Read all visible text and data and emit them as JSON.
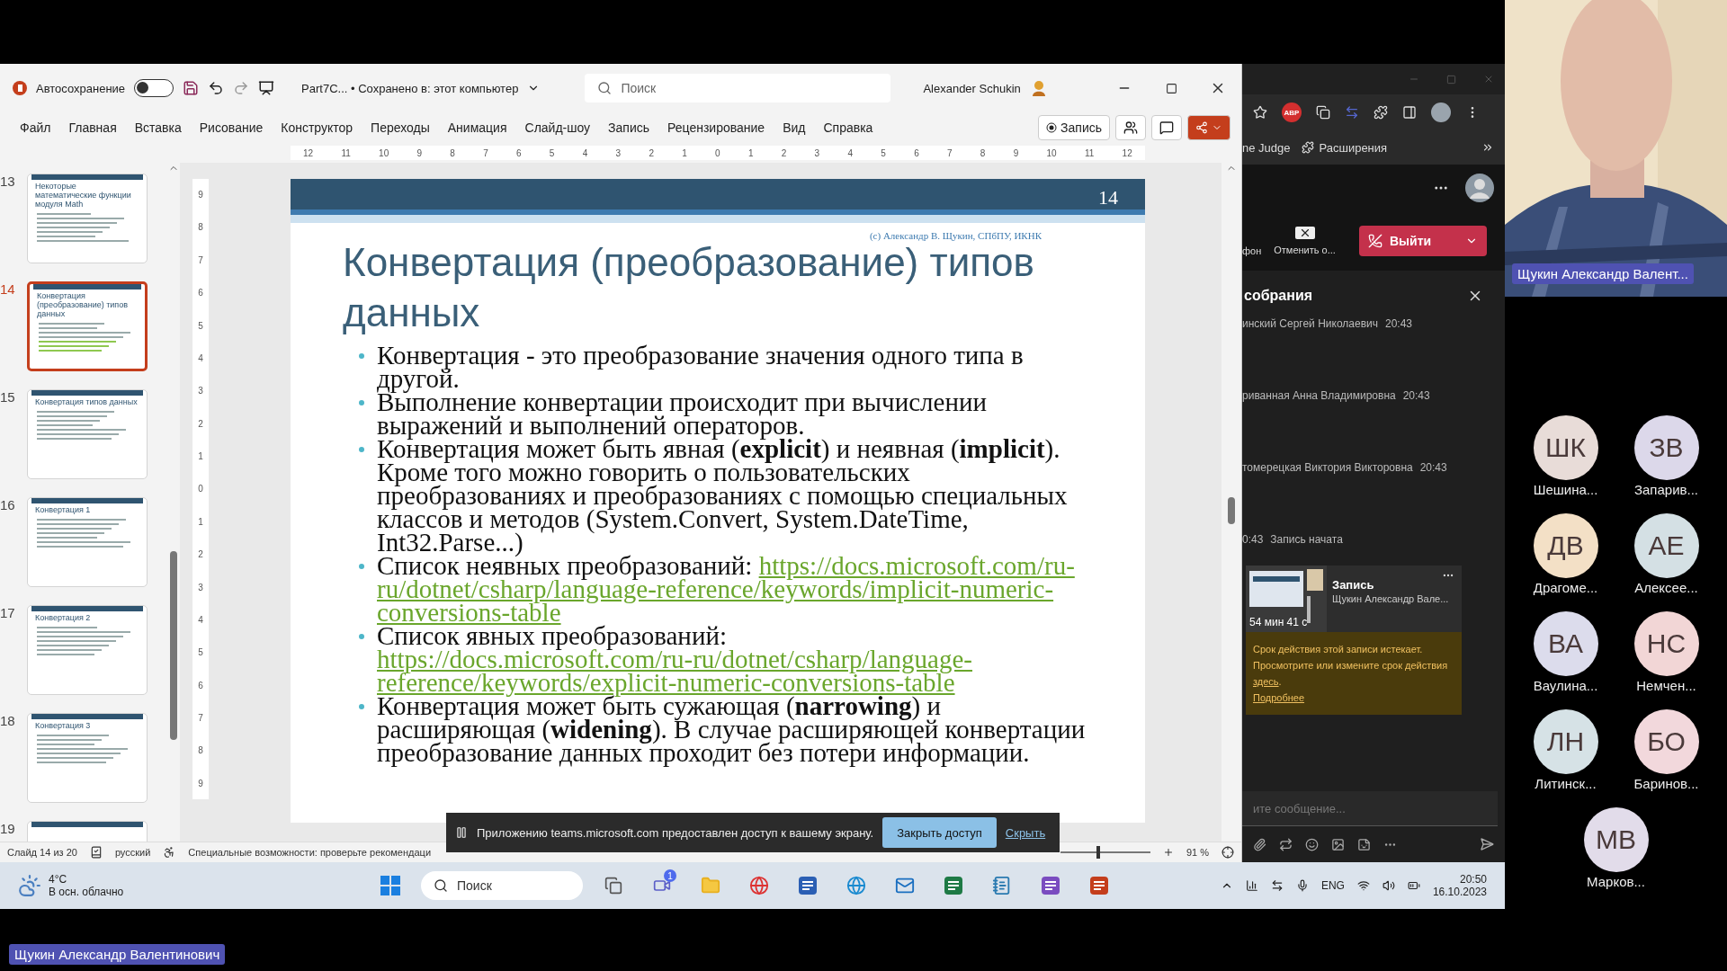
{
  "ppt": {
    "autosave": {
      "label": "Автосохранение",
      "on": false
    },
    "file_title": "Part7C... • Сохранено в: этот компьютер",
    "search": {
      "placeholder": "Поиск"
    },
    "user": "Alexander Schukin",
    "tabs": [
      "Файл",
      "Главная",
      "Вставка",
      "Рисование",
      "Конструктор",
      "Переходы",
      "Анимация",
      "Слайд-шоу",
      "Запись",
      "Рецензирование",
      "Вид",
      "Справка"
    ],
    "record_button": "Запись",
    "ruler_h": [
      "12",
      "11",
      "10",
      "9",
      "8",
      "7",
      "6",
      "5",
      "4",
      "3",
      "2",
      "1",
      "0",
      "1",
      "2",
      "3",
      "4",
      "5",
      "6",
      "7",
      "8",
      "9",
      "10",
      "11",
      "12"
    ],
    "ruler_v": [
      "9",
      "8",
      "7",
      "6",
      "5",
      "4",
      "3",
      "2",
      "1",
      "0",
      "1",
      "2",
      "3",
      "4",
      "5",
      "6",
      "7",
      "8",
      "9"
    ],
    "thumbnails": [
      {
        "number": "13",
        "title": "Некоторые математические функции модуля Math",
        "selected": false
      },
      {
        "number": "14",
        "title": "Конвертация (преобразование) типов данных",
        "selected": true
      },
      {
        "number": "15",
        "title": "Конвертация типов данных",
        "selected": false
      },
      {
        "number": "16",
        "title": "Конвертация 1",
        "selected": false
      },
      {
        "number": "17",
        "title": "Конвертация 2",
        "selected": false
      },
      {
        "number": "18",
        "title": "Конвертация 3",
        "selected": false
      },
      {
        "number": "19",
        "selected": false
      }
    ],
    "slide": {
      "number": "14",
      "copyright": "(c) Александр В. Щукин, СПбПУ, ИКНК",
      "title": "Конвертация (преобразование) типов данных",
      "bullets": [
        {
          "kind": "text",
          "text": "Конвертация - это преобразование значения одного типа в другой."
        },
        {
          "kind": "text",
          "text": "Выполнение конвертации происходит при вычислении выражений и выполнений операторов."
        },
        {
          "kind": "text",
          "text": "Конвертация может быть явная (**explicit**) и неявная (**implicit**). Кроме того можно говорить о пользовательских преобразованиях и преобразованиях с помощью специальных классов и методов (System.Convert, System.DateTime, Int32.Parse...)"
        },
        {
          "kind": "link",
          "text": "Список неявных преобразований: ",
          "link_lines": [
            "https://docs.microsoft.com/ru-",
            "ru/dotnet/csharp/language-reference/keywords/implicit-numeric-",
            "conversions-table"
          ]
        },
        {
          "kind": "link",
          "text": "Список явных преобразований:",
          "link_lines": [
            "https://docs.microsoft.com/ru-ru/dotnet/csharp/language-",
            "reference/keywords/explicit-numeric-conversions-table"
          ]
        },
        {
          "kind": "text",
          "text": "Конвертация может быть сужающая (**narrowing**) и расширяющая (**widening**). В случае расширяющей конвертации преобразование данных проходит без потери информации."
        }
      ]
    },
    "status": {
      "slide": "Слайд 14 из 20",
      "language": "русский",
      "accessibility": "Специальные возможности: проверьте рекомендаци",
      "zoom": "91 %",
      "zoom_slider": {
        "level": 0.4
      }
    }
  },
  "share_bar": {
    "message": "Приложению teams.microsoft.com предоставлен доступ к вашему экрану.",
    "stop": "Закрыть доступ",
    "hide": "Скрыть"
  },
  "taskbar": {
    "temperature": "4°C",
    "weather": "В осн. облачно",
    "search": "Поиск",
    "chat_badge": "1",
    "language": "ENG",
    "time": "20:50",
    "date": "16.10.2023"
  },
  "browser": {
    "adblock": "ABP",
    "bookmark": "ne Judge",
    "extensions": "Расширения",
    "actions": [
      "фон",
      "Отменить о..."
    ],
    "leave": "Выйти",
    "chat_title": "собрания",
    "messages": [
      {
        "name": "инский Сергей Николаевич",
        "time": "20:43"
      },
      {
        "name": "риванная Анна Владимировна",
        "time": "20:43"
      },
      {
        "name": "томерецкая Виктория Викторовна",
        "time": "20:43"
      }
    ],
    "event": {
      "time": "0:43",
      "text": "Запись начата"
    },
    "recording": {
      "duration": "54 мин 41 с",
      "title": "Запись",
      "owner": "Щукин Александр Вале..."
    },
    "notice": {
      "text": "Срок действия этой записи истекает. Просмотрите или измените срок действия ",
      "link": "здесь",
      "after": ".",
      "more": "Подробнее"
    },
    "composer": {
      "placeholder": "ите сообщение..."
    }
  },
  "video": {
    "name": "Щукин Александр Валент..."
  },
  "participants": [
    {
      "initials": "ШК",
      "name": "Шешина...",
      "color": "#e8dcd8"
    },
    {
      "initials": "ЗВ",
      "name": "Запарив...",
      "color": "#dcd8ea"
    },
    {
      "initials": "ДВ",
      "name": "Драгоме...",
      "color": "#f3e0c6"
    },
    {
      "initials": "АЕ",
      "name": "Алексее...",
      "color": "#d4e0e4"
    },
    {
      "initials": "ВА",
      "name": "Ваулина...",
      "color": "#dcdcec"
    },
    {
      "initials": "НС",
      "name": "Немчен...",
      "color": "#f2d6d6"
    },
    {
      "initials": "ЛН",
      "name": "Литинск...",
      "color": "#d6e2e6"
    },
    {
      "initials": "БО",
      "name": "Баринов...",
      "color": "#f2d8dc"
    },
    {
      "initials": "МВ",
      "name": "Марков...",
      "color": "#e2dcea"
    }
  ],
  "presenter_label": "Щукин Александр Валентинович"
}
